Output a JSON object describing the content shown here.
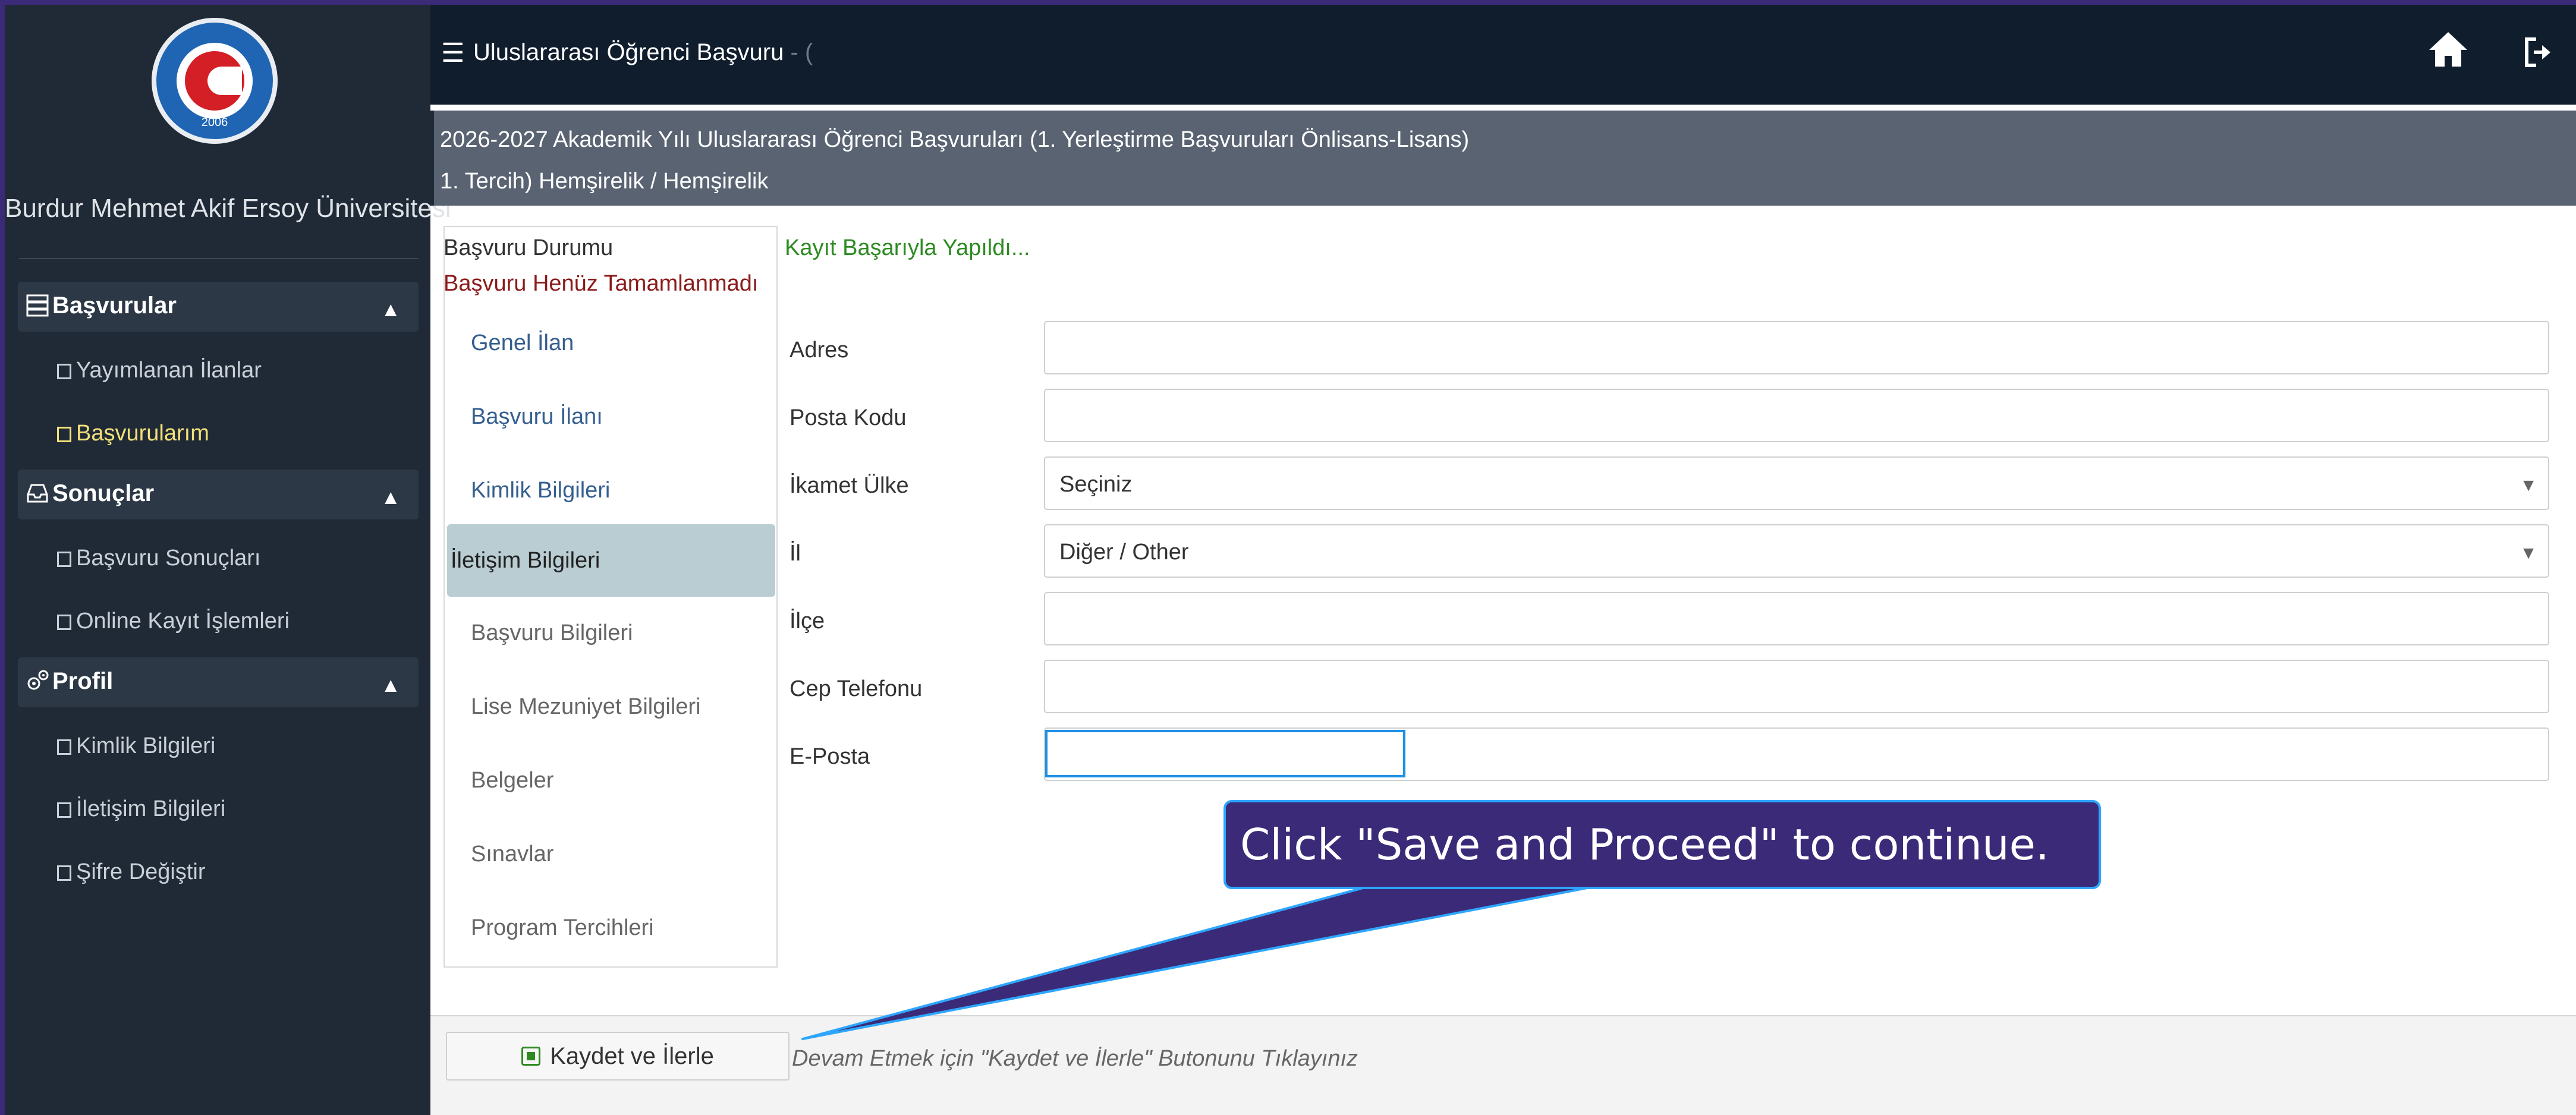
{
  "sidebar": {
    "logo_year": "2006",
    "university_name": "Burdur Mehmet Akif Ersoy Üniversitesi",
    "sections": [
      {
        "label": "Başvurular",
        "icon": "server-icon"
      },
      {
        "label": "Sonuçlar",
        "icon": "inbox-icon"
      },
      {
        "label": "Profil",
        "icon": "gears-icon"
      }
    ],
    "items": {
      "yayimlanan": "Yayımlanan İlanlar",
      "basvurularim": "Başvurularım",
      "basvuru_sonuclari": "Başvuru Sonuçları",
      "online_kayit": "Online Kayıt İşlemleri",
      "kimlik": "Kimlik Bilgileri",
      "iletisim": "İletişim Bilgileri",
      "sifre": "Şifre Değiştir"
    }
  },
  "topbar": {
    "title": "Uluslararası Öğrenci Başvuru",
    "title_suffix": "- (",
    "icons": [
      "menu-icon",
      "home-icon",
      "logout-icon"
    ]
  },
  "header": {
    "line1": "2026-2027 Akademik Yılı Uluslararası Öğrenci Başvuruları (1. Yerleştirme Başvuruları Önlisans-Lisans)",
    "line2": "1. Tercih) Hemşirelik / Hemşirelik"
  },
  "left_nav": {
    "status_label": "Başvuru Durumu",
    "status_value": "Başvuru Henüz Tamamlanmadı",
    "items": [
      "Genel İlan",
      "Başvuru İlanı",
      "Kimlik Bilgileri",
      "İletişim Bilgileri",
      "Başvuru Bilgileri",
      "Lise Mezuniyet Bilgileri",
      "Belgeler",
      "Sınavlar",
      "Program Tercihleri"
    ],
    "active": "İletişim Bilgileri"
  },
  "form": {
    "success_message": "Kayıt Başarıyla Yapıldı...",
    "fields": {
      "adres": {
        "label": "Adres",
        "value": ""
      },
      "posta_kodu": {
        "label": "Posta Kodu",
        "value": ""
      },
      "ikamet_ulke": {
        "label": "İkamet Ülke",
        "value": "Seçiniz"
      },
      "il": {
        "label": "İl",
        "value": "Diğer / Other"
      },
      "ilce": {
        "label": "İlçe",
        "value": ""
      },
      "cep_telefonu": {
        "label": "Cep Telefonu",
        "value": ""
      },
      "eposta": {
        "label": "E-Posta",
        "value": ""
      }
    }
  },
  "footer": {
    "save_button": "Kaydet ve İlerle",
    "hint": "Devam Etmek için \"Kaydet ve İlerle\" Butonunu Tıklayınız"
  },
  "callout": {
    "text": "Click \"Save and Proceed\" to continue."
  },
  "colors": {
    "sidebar_bg": "#1f2a36",
    "topbar_bg": "#101d2d",
    "header_bg": "#596372",
    "active_item": "#f4e07a",
    "success": "#2e8b22",
    "status_warning": "#8b1b1b",
    "callout_bg": "#3b2a78",
    "callout_border": "#2ea6ff"
  }
}
